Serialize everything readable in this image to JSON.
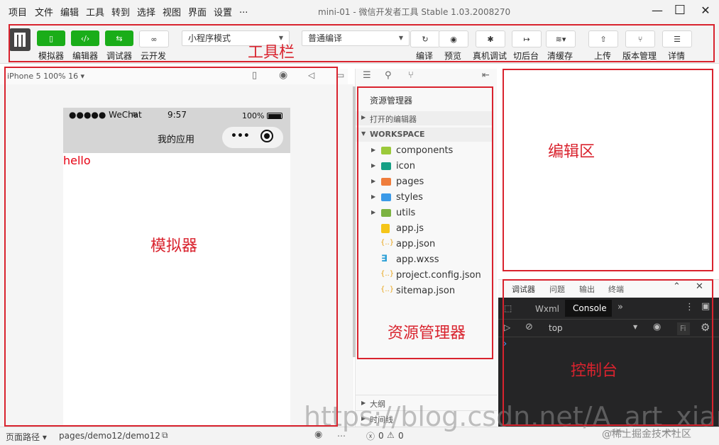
{
  "menu": {
    "items": [
      "项目",
      "文件",
      "编辑",
      "工具",
      "转到",
      "选择",
      "视图",
      "界面",
      "设置",
      "..."
    ],
    "window_title": "mini-01 - 微信开发者工具 Stable 1.03.2008270",
    "minimize": "—",
    "maximize": "☐",
    "close": "✕"
  },
  "toolbar": {
    "simulator_label": "模拟器",
    "editor_label": "编辑器",
    "debugger_label": "调试器",
    "cloud_label": "云开发",
    "mode_select": "小程序模式",
    "compile_select": "普通编译",
    "compile_label": "编译",
    "preview_label": "预览",
    "realdebug_label": "真机调试",
    "background_label": "切后台",
    "cache_label": "清缓存",
    "upload_label": "上传",
    "version_label": "版本管理",
    "details_label": "详情"
  },
  "annotations": {
    "toolbar": "工具栏",
    "simulator": "模拟器",
    "explorer": "资源管理器",
    "editor": "编辑区",
    "console": "控制台",
    "accent": "#d9232e"
  },
  "simulator": {
    "device": "iPhone 5 100% 16 ▾",
    "carrier": "●●●●● WeChat",
    "time": "9:57",
    "battery": "100%",
    "nav_title": "我的应用",
    "capsule_dots": "•••",
    "content_text": "hello"
  },
  "explorer": {
    "title": "资源管理器",
    "open_editors": "打开的编辑器",
    "workspace": "WORKSPACE",
    "folders": [
      {
        "name": "components",
        "color": "#9bc93a"
      },
      {
        "name": "icon",
        "color": "#16a085"
      },
      {
        "name": "pages",
        "color": "#ef7d3c"
      },
      {
        "name": "styles",
        "color": "#3b9ae8"
      },
      {
        "name": "utils",
        "color": "#7cb342"
      }
    ],
    "files": [
      {
        "name": "app.js",
        "icon": "JS",
        "color": "#f5c518"
      },
      {
        "name": "app.json",
        "icon": "{..}",
        "color": "#e8a317"
      },
      {
        "name": "app.wxss",
        "icon": "css-icon",
        "color": "#2a9fd6"
      },
      {
        "name": "project.config.json",
        "icon": "{..}",
        "color": "#e8a317"
      },
      {
        "name": "sitemap.json",
        "icon": "{..}",
        "color": "#e8a317"
      }
    ],
    "outline": "大纲",
    "timeline": "时间线"
  },
  "console": {
    "tabs": [
      "调试器",
      "问题",
      "输出",
      "终端"
    ],
    "subtabs": [
      "Wxml",
      "Console"
    ],
    "context": "top",
    "filter": "Fi",
    "prompt": "›"
  },
  "status": {
    "page_path_label": "页面路径 ▾",
    "page_path": "pages/demo12/demo12",
    "errors": "0",
    "warnings": "0",
    "watermark": "https://blog.csdn.net/A_art_xiang",
    "watermark2": "@稀土掘金技术社区"
  }
}
